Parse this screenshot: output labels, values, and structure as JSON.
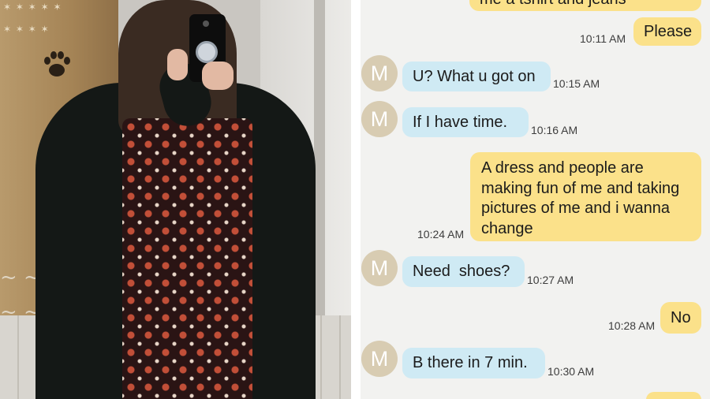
{
  "chat": {
    "partial_top_text": "me a tshirt and jeans",
    "contact_initial": "M",
    "messages": [
      {
        "side": "out",
        "text": "Please",
        "time": "10:11 AM"
      },
      {
        "side": "in",
        "text": "U? What u got on",
        "time": "10:15 AM"
      },
      {
        "side": "in",
        "text": "If I have time.",
        "time": "10:16 AM"
      },
      {
        "side": "out",
        "text": "A dress and people are making fun of me and taking pictures of me and i wanna change",
        "time": "10:24 AM"
      },
      {
        "side": "in",
        "text": "Need  shoes?",
        "time": "10:27 AM"
      },
      {
        "side": "out",
        "text": "No",
        "time": "10:28 AM"
      },
      {
        "side": "in",
        "text": "B there in 7 min.",
        "time": "10:30 AM"
      }
    ]
  },
  "colors": {
    "incoming_bubble": "#cfeaf4",
    "outgoing_bubble": "#fbe18a",
    "avatar": "#d8ccb2",
    "chat_background": "#f2f2f0"
  },
  "icons": [
    "paw-print-icon"
  ]
}
